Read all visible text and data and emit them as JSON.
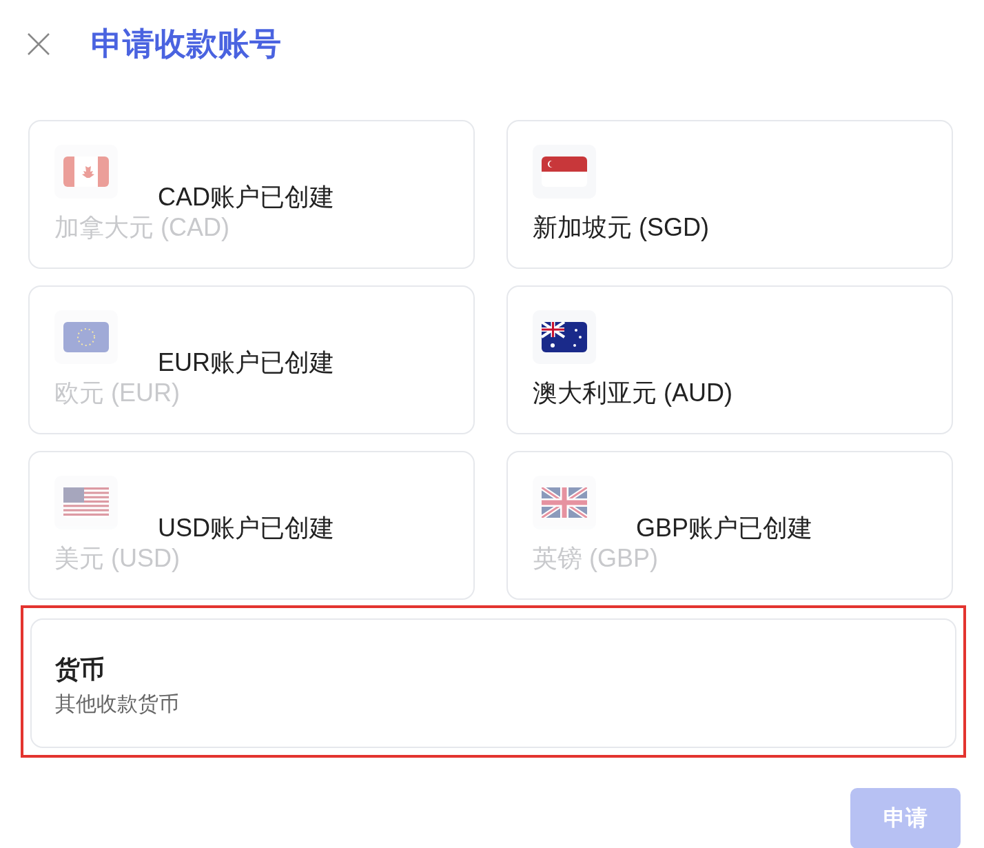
{
  "dialog": {
    "title": "申请收款账号"
  },
  "currencies": [
    {
      "label": "加拿大元 (CAD)",
      "created": true,
      "status": "CAD账户已创建"
    },
    {
      "label": "新加坡元 (SGD)",
      "created": false
    },
    {
      "label": "欧元 (EUR)",
      "created": true,
      "status": "EUR账户已创建"
    },
    {
      "label": "澳大利亚元 (AUD)",
      "created": false
    },
    {
      "label": "美元 (USD)",
      "created": true,
      "status": "USD账户已创建"
    },
    {
      "label": "英镑 (GBP)",
      "created": true,
      "status": "GBP账户已创建"
    }
  ],
  "other": {
    "title": "货币",
    "subtitle": "其他收款货币",
    "highlighted": true
  },
  "apply_button": {
    "label": "申请",
    "disabled": true
  }
}
